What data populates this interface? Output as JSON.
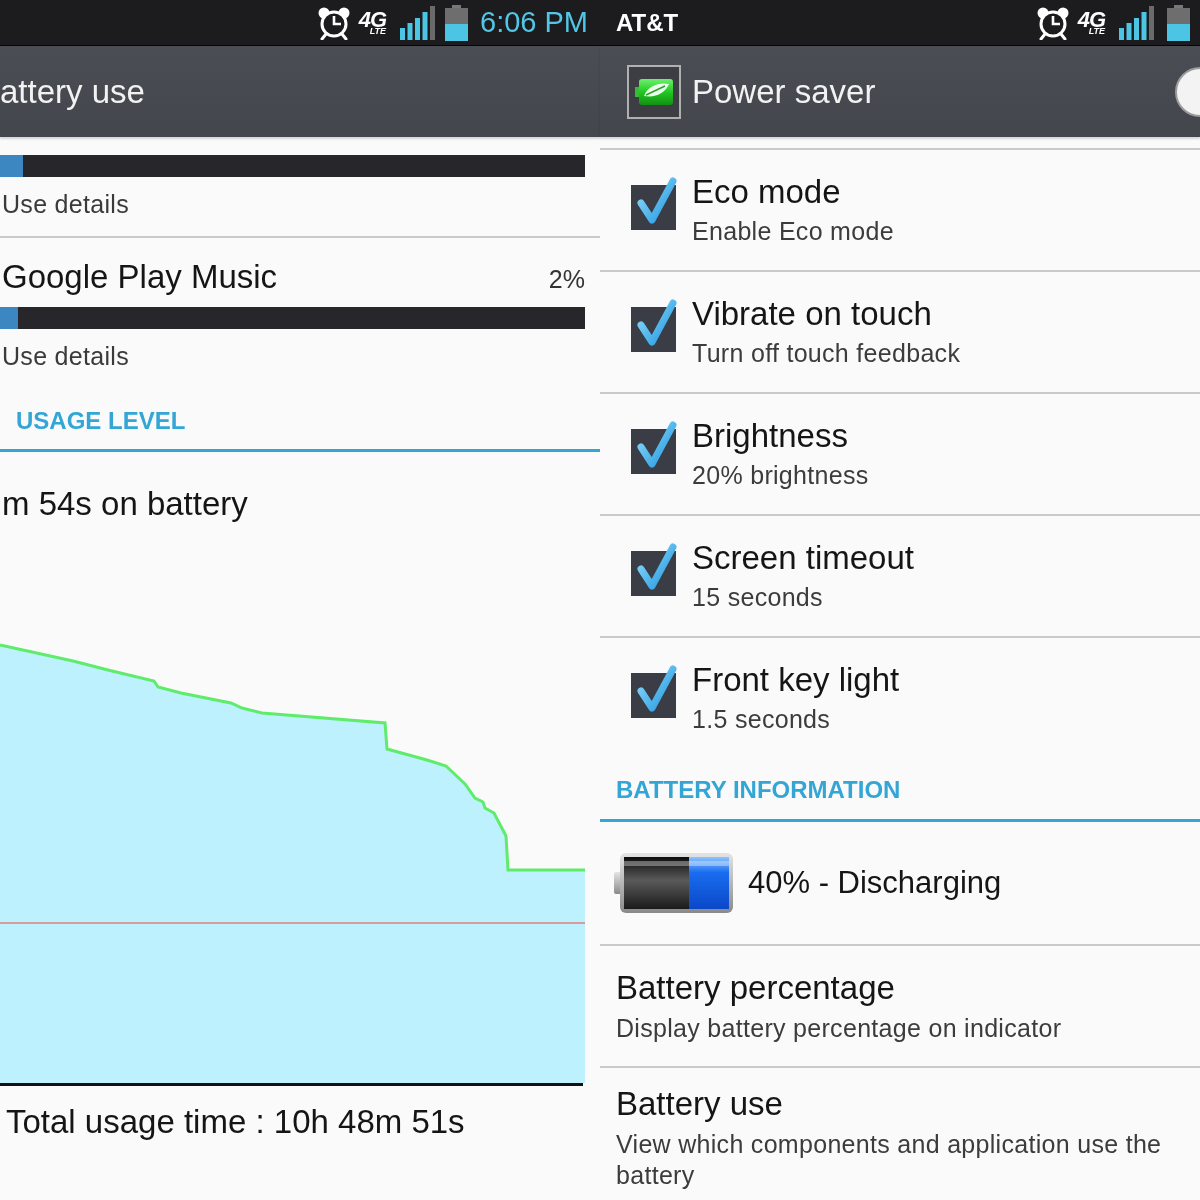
{
  "left_screen": {
    "status_bar": {
      "network": "4G",
      "network_sub": "LTE",
      "time": "6:06 PM"
    },
    "action_bar": {
      "title": "attery use"
    },
    "usage_items": [
      {
        "level": 0.04,
        "detail": "Use details"
      },
      {
        "name": "Google Play Music",
        "percent": "2%",
        "level": 0.03,
        "detail": "Use details"
      }
    ],
    "section_header": "USAGE LEVEL",
    "battery_time": "m 54s on battery",
    "total_usage": "Total usage time : 10h 48m 51s"
  },
  "right_screen": {
    "status_bar": {
      "carrier": "AT&T",
      "network": "4G",
      "network_sub": "LTE"
    },
    "action_bar": {
      "title": "Power saver",
      "switch_on": false
    },
    "settings": [
      {
        "title": "Eco mode",
        "summary": "Enable Eco mode",
        "checked": true
      },
      {
        "title": "Vibrate on touch",
        "summary": "Turn off touch feedback",
        "checked": true
      },
      {
        "title": "Brightness",
        "summary": "20% brightness",
        "checked": true
      },
      {
        "title": "Screen timeout",
        "summary": "15 seconds",
        "checked": true
      },
      {
        "title": "Front key light",
        "summary": "1.5 seconds",
        "checked": true
      }
    ],
    "section_header": "BATTERY INFORMATION",
    "battery_status": "40% - Discharging",
    "info_items": [
      {
        "title": "Battery percentage",
        "summary": "Display battery percentage on indicator"
      },
      {
        "title": "Battery use",
        "summary": "View which components and application use the battery"
      }
    ]
  }
}
